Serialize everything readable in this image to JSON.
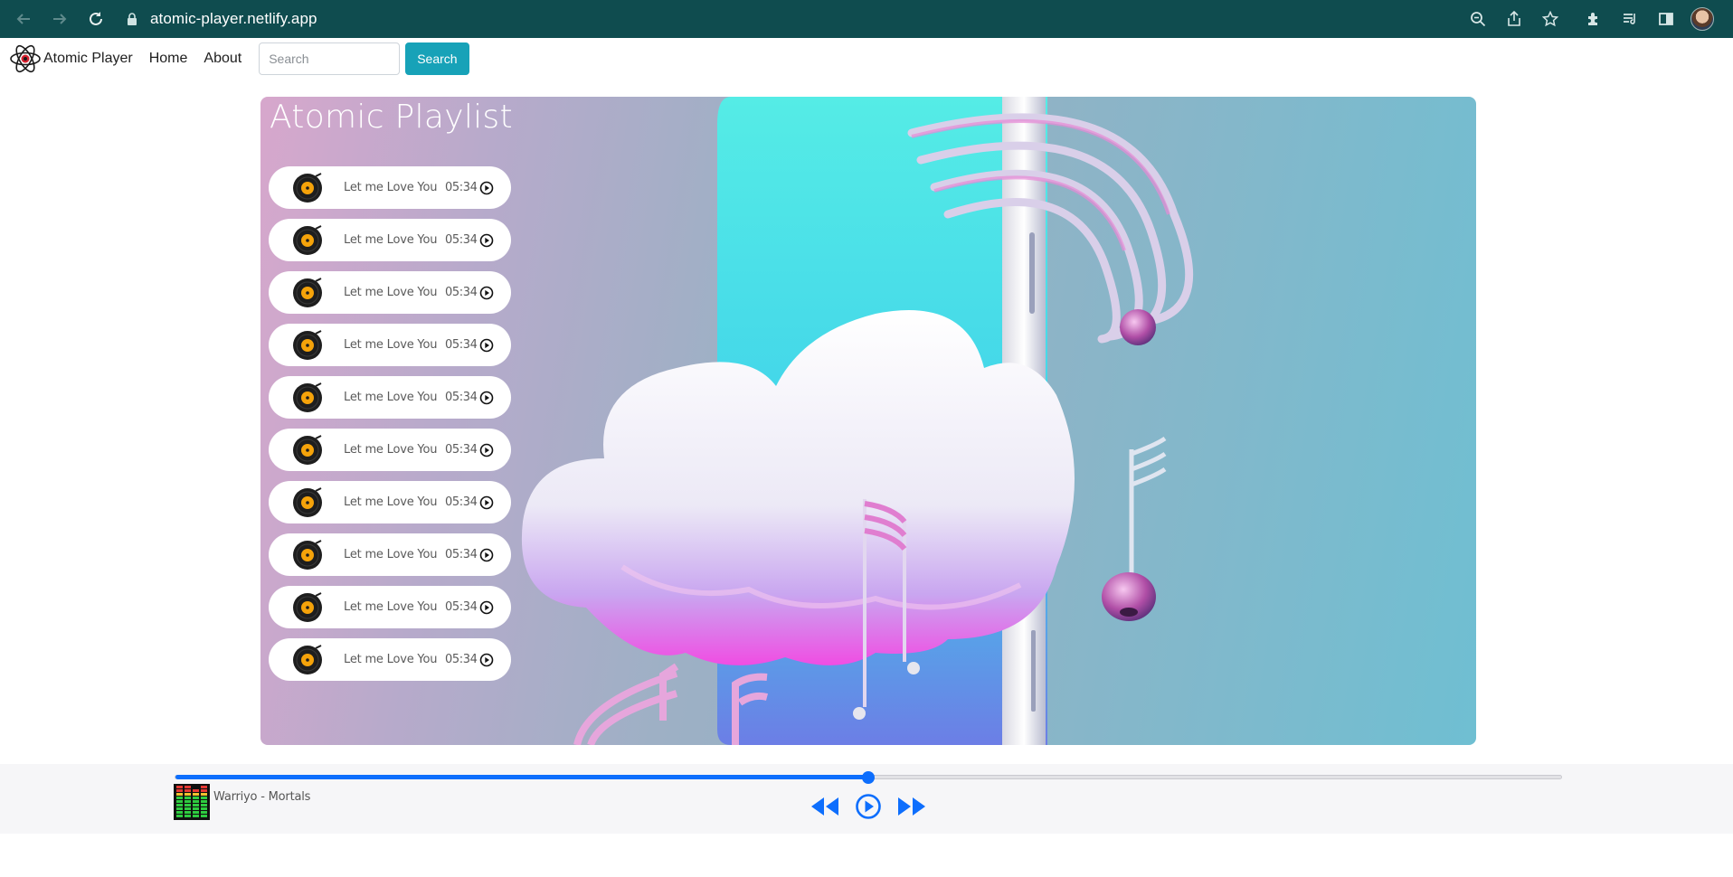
{
  "browser": {
    "url": "atomic-player.netlify.app",
    "icons": [
      "back-icon",
      "forward-icon",
      "reload-icon",
      "lock-icon",
      "zoom-icon",
      "share-icon",
      "star-icon",
      "extensions-icon",
      "reading-list-icon",
      "side-panel-icon",
      "profile-avatar"
    ]
  },
  "navbar": {
    "brand": "Atomic Player",
    "links": [
      "Home",
      "About"
    ],
    "search_placeholder": "Search",
    "search_button": "Search",
    "accent": "#17a2b8"
  },
  "playlist": {
    "title": "Atomic Playlist",
    "tracks": [
      {
        "title": "Let me Love You",
        "duration": "05:34"
      },
      {
        "title": "Let me Love You",
        "duration": "05:34"
      },
      {
        "title": "Let me Love You",
        "duration": "05:34"
      },
      {
        "title": "Let me Love You",
        "duration": "05:34"
      },
      {
        "title": "Let me Love You",
        "duration": "05:34"
      },
      {
        "title": "Let me Love You",
        "duration": "05:34"
      },
      {
        "title": "Let me Love You",
        "duration": "05:34"
      },
      {
        "title": "Let me Love You",
        "duration": "05:34"
      },
      {
        "title": "Let me Love You",
        "duration": "05:34"
      },
      {
        "title": "Let me Love You",
        "duration": "05:34"
      }
    ]
  },
  "player": {
    "now_playing": "Warriyo - Mortals",
    "progress": 0.5,
    "accent": "#0d6efd"
  }
}
